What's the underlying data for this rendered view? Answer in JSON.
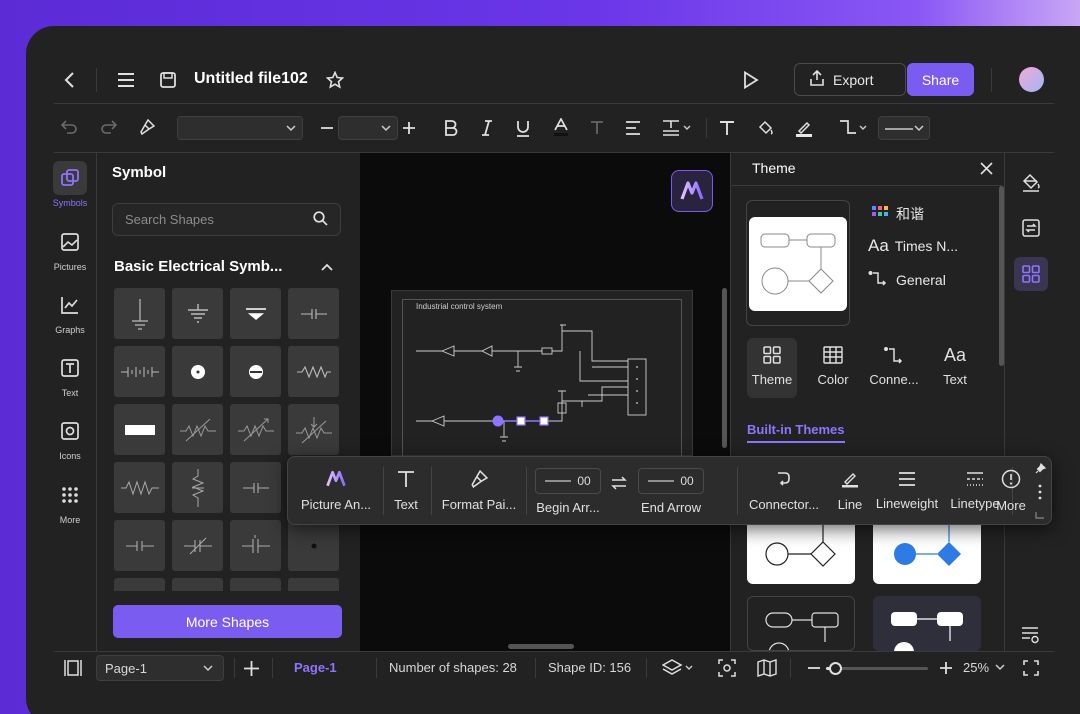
{
  "header": {
    "file_title": "Untitled file102",
    "export_label": "Export",
    "share_label": "Share"
  },
  "left_rail": {
    "items": [
      {
        "label": "Symbols",
        "icon": "symbols-icon"
      },
      {
        "label": "Pictures",
        "icon": "pictures-icon"
      },
      {
        "label": "Graphs",
        "icon": "graphs-icon"
      },
      {
        "label": "Text",
        "icon": "text-icon"
      },
      {
        "label": "Icons",
        "icon": "icons-icon"
      },
      {
        "label": "More",
        "icon": "more-grid-icon"
      }
    ]
  },
  "symbol_panel": {
    "title": "Symbol",
    "search_placeholder": "Search Shapes",
    "category": "Basic Electrical Symb...",
    "more_shapes_label": "More Shapes"
  },
  "canvas": {
    "diagram_title": "Industrial control system"
  },
  "theme_panel": {
    "title": "Theme",
    "preset_name": "和谐",
    "font_name": "Times N...",
    "connector_style": "General",
    "tabs": [
      {
        "label": "Theme"
      },
      {
        "label": "Color"
      },
      {
        "label": "Conne..."
      },
      {
        "label": "Text"
      }
    ],
    "section_label": "Built-in Themes"
  },
  "floating_toolbar": {
    "items": {
      "picture_an": "Picture An...",
      "text": "Text",
      "format_painter": "Format Pai...",
      "begin_arrow": "Begin Arr...",
      "end_arrow": "End Arrow",
      "connector": "Connector...",
      "line": "Line",
      "lineweight": "Lineweight",
      "linetype": "Linetype",
      "more": "More"
    },
    "begin_arrow_value": "00",
    "end_arrow_value": "00"
  },
  "status_bar": {
    "page_select": "Page-1",
    "page_tab": "Page-1",
    "shape_count": "Number of shapes: 28",
    "shape_id": "Shape ID: 156",
    "zoom": "25%",
    "zoom_fraction": 0.06
  },
  "colors": {
    "accent": "#7b5cf0",
    "frame_bg": "#222222",
    "canvas_bg": "#0b0b0b"
  }
}
